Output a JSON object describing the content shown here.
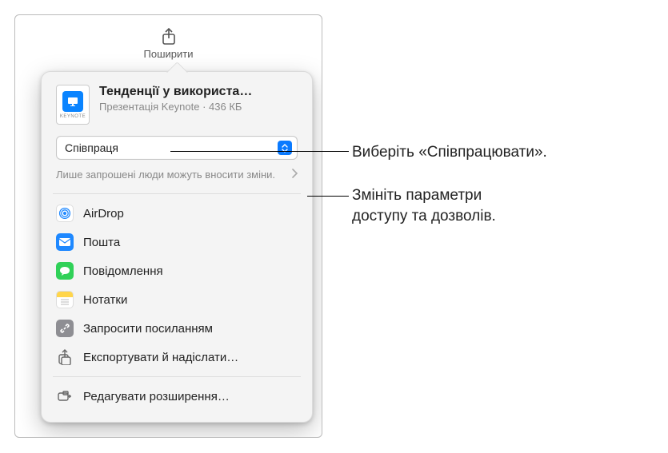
{
  "toolbar": {
    "share_label": "Поширити"
  },
  "file": {
    "title": "Тенденції у використа…",
    "type": "Презентація Keynote",
    "size": "436 КБ",
    "icon_label": "KEYNOTE"
  },
  "mode": {
    "selected": "Співпраця"
  },
  "permissions": {
    "summary": "Лише запрошені люди можуть вносити зміни."
  },
  "share_options": {
    "airdrop": "AirDrop",
    "mail": "Пошта",
    "messages": "Повідомлення",
    "notes": "Нотатки",
    "invite_link": "Запросити посиланням",
    "export_send": "Експортувати й надіслати…",
    "edit_extensions": "Редагувати розширення…"
  },
  "callouts": {
    "choose": "Виберіть «Співпрацювати».",
    "perms_l1": "Змініть параметри",
    "perms_l2": "доступу та дозволів."
  }
}
